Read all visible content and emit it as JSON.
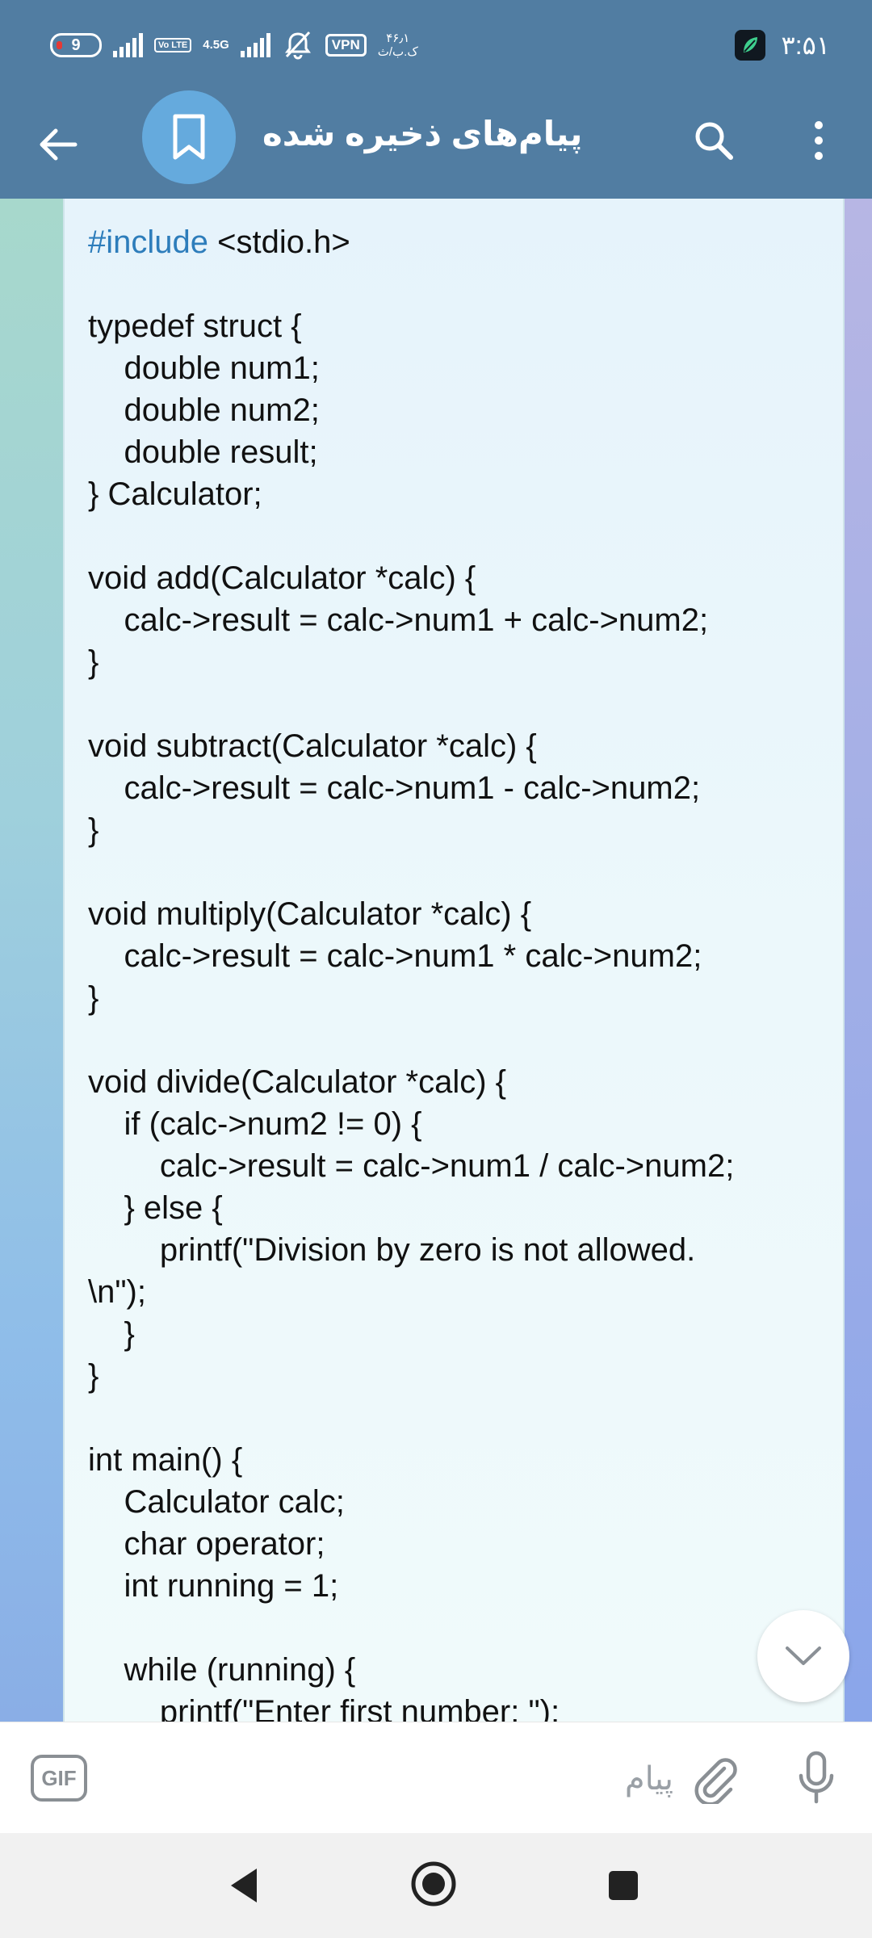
{
  "status_bar": {
    "battery_level": "9",
    "volte_label": "Vo LTE",
    "network_type": "4.5G",
    "vpn_label": "VPN",
    "speed_value": "۴۶٫۱",
    "speed_unit": "ک.ب/ث",
    "time": "۳:۵۱"
  },
  "header": {
    "title": "پیام‌های ذخیره شده"
  },
  "code_lines": [
    "#include <stdio.h>",
    "",
    "typedef struct {",
    "    double num1;",
    "    double num2;",
    "    double result;",
    "} Calculator;",
    "",
    "void add(Calculator *calc) {",
    "    calc->result = calc->num1 + calc->num2;",
    "}",
    "",
    "void subtract(Calculator *calc) {",
    "    calc->result = calc->num1 - calc->num2;",
    "}",
    "",
    "void multiply(Calculator *calc) {",
    "    calc->result = calc->num1 * calc->num2;",
    "}",
    "",
    "void divide(Calculator *calc) {",
    "    if (calc->num2 != 0) {",
    "        calc->result = calc->num1 / calc->num2;",
    "    } else {",
    "        printf(\"Division by zero is not allowed.",
    "\\n\");",
    "    }",
    "}",
    "",
    "int main() {",
    "    Calculator calc;",
    "    char operator;",
    "    int running = 1;",
    "",
    "    while (running) {",
    "        printf(\"Enter first number: \");"
  ],
  "input_bar": {
    "gif_label": "GIF",
    "placeholder": "پیام"
  },
  "colors": {
    "header_bg": "#517da2",
    "avatar_bg": "#65aadd",
    "include_keyword": "#2d7dbb"
  }
}
